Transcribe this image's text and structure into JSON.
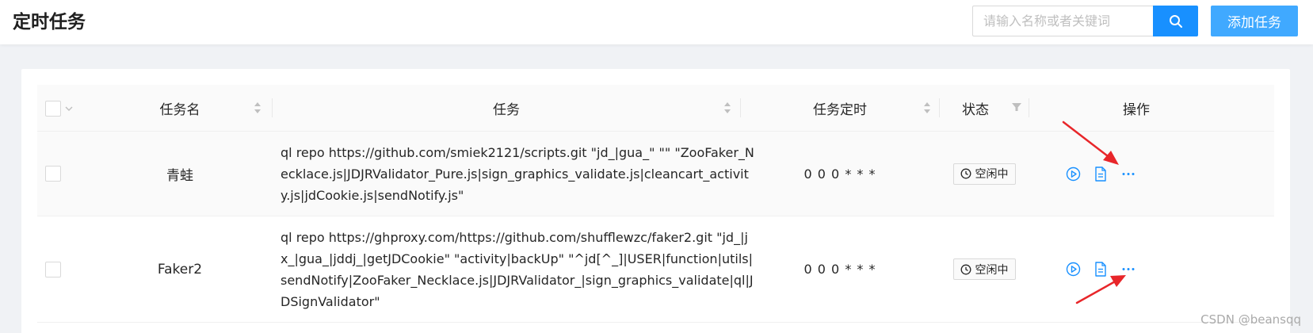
{
  "header": {
    "title": "定时任务",
    "search_placeholder": "请输入名称或者关键词",
    "add_button_label": "添加任务"
  },
  "table": {
    "columns": [
      "任务名",
      "任务",
      "任务定时",
      "状态",
      "操作"
    ],
    "rows": [
      {
        "name": "青蛙",
        "command": "ql repo https://github.com/smiek2121/scripts.git \"jd_|gua_\" \"\" \"ZooFaker_Necklace.js|JDJRValidator_Pure.js|sign_graphics_validate.js|cleancart_activity.js|jdCookie.js|sendNotify.js\"",
        "schedule": "0 0 0 * * *",
        "status": "空闲中"
      },
      {
        "name": "Faker2",
        "command": "ql repo https://ghproxy.com/https://github.com/shufflewzc/faker2.git \"jd_|jx_|gua_|jddj_|getJDCookie\" \"activity|backUp\" \"^jd[^_]|USER|function|utils|sendNotify|ZooFaker_Necklace.js|JDJRValidator_|sign_graphics_validate|ql|JDSignValidator\"",
        "schedule": "0 0 0 * * *",
        "status": "空闲中"
      }
    ]
  },
  "watermark": "CSDN @beansqq",
  "colors": {
    "primary": "#1890ff",
    "add_button": "#40a9ff",
    "annotation_arrow": "#e8262a"
  },
  "icons": [
    "search-icon",
    "sort-icon",
    "filter-icon",
    "clock-icon",
    "play-circle-icon",
    "file-text-icon",
    "more-icon",
    "arrow-annotation"
  ]
}
